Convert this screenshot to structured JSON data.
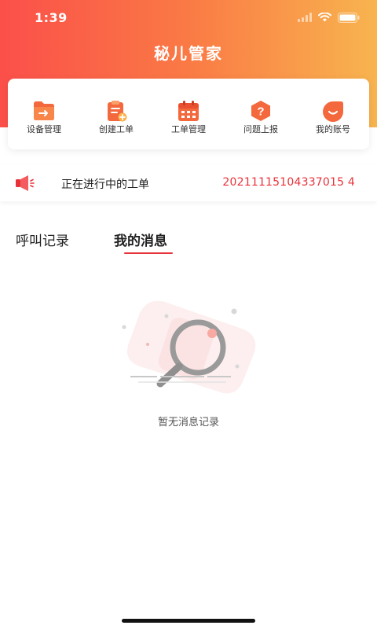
{
  "status_bar": {
    "time": "1:39"
  },
  "app": {
    "title": "秘儿管家"
  },
  "quick_actions": [
    {
      "label": "设备管理",
      "icon": "folder-arrow-icon"
    },
    {
      "label": "创建工单",
      "icon": "clipboard-add-icon"
    },
    {
      "label": "工单管理",
      "icon": "calendar-icon"
    },
    {
      "label": "问题上报",
      "icon": "question-hexagon-icon"
    },
    {
      "label": "我的账号",
      "icon": "account-drop-icon"
    }
  ],
  "ongoing": {
    "label": "正在进行中的工单",
    "order_number": "20211115104337015 4"
  },
  "tabs": [
    {
      "label": "呼叫记录",
      "active": false
    },
    {
      "label": "我的消息",
      "active": true
    }
  ],
  "empty_state": {
    "text": "暂无消息记录"
  },
  "colors": {
    "header_gradient_start": "#fb4f4a",
    "header_gradient_end": "#f8b44f",
    "accent_red": "#e8323a",
    "icon_orange": "#f25a3a"
  }
}
